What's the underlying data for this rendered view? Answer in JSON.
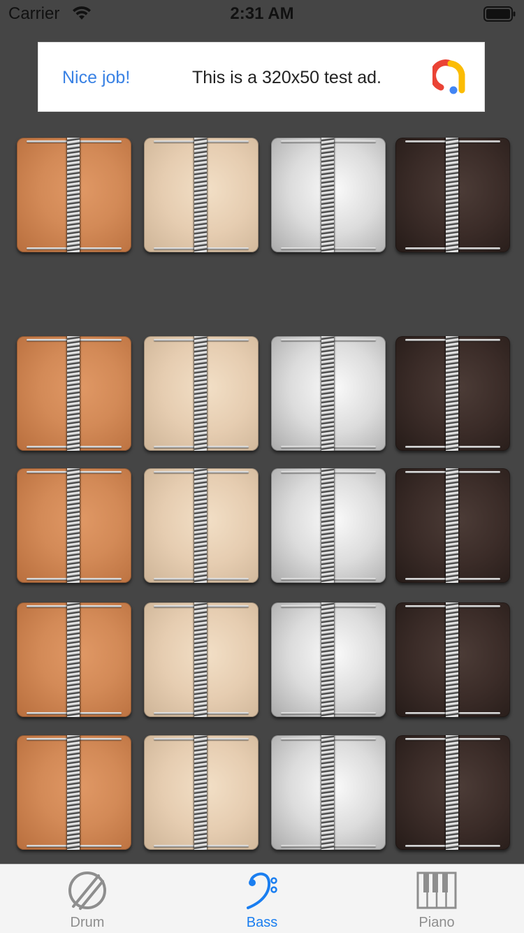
{
  "status_bar": {
    "carrier": "Carrier",
    "time": "2:31 AM"
  },
  "ad": {
    "headline": "Nice job!",
    "text": "This is a 320x50 test ad.",
    "logo": "ad-choices-logo"
  },
  "pads": {
    "columns": [
      "orange",
      "beige",
      "silver",
      "dark"
    ],
    "rows": 5
  },
  "colors": {
    "background": "#454545",
    "tab_active": "#1a7ef0",
    "tab_inactive": "#8e8e8e",
    "ad_accent": "#3a82e4"
  },
  "tabs": [
    {
      "label": "Drum",
      "icon": "drum-icon",
      "active": false
    },
    {
      "label": "Bass",
      "icon": "bass-clef-icon",
      "active": true
    },
    {
      "label": "Piano",
      "icon": "piano-keys-icon",
      "active": false
    }
  ]
}
